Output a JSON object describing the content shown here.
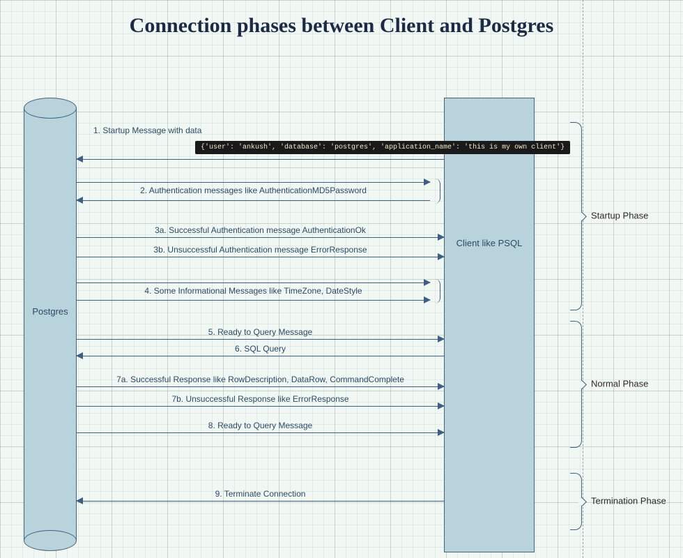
{
  "title": "Connection phases between Client and Postgres",
  "left_entity": "Postgres",
  "right_entity": "Client like PSQL",
  "code_snippet": "{'user': 'ankush', 'database': 'postgres', 'application_name': 'this is my own client'}",
  "messages": {
    "m1": "1. Startup Message with data",
    "m2": "2. Authentication messages like AuthenticationMD5Password",
    "m3a": "3a. Successful Authentication message AuthenticationOk",
    "m3b": "3b. Unsuccessful Authentication message ErrorResponse",
    "m4": "4. Some Informational Messages like TimeZone, DateStyle",
    "m5": "5. Ready to Query Message",
    "m6": "6. SQL Query",
    "m7a": "7a. Successful Response like RowDescription, DataRow,  CommandComplete",
    "m7b": "7b. Unsuccessful Response like ErrorResponse",
    "m8": "8. Ready to Query Message",
    "m9": "9. Terminate Connection"
  },
  "phases": {
    "startup": "Startup Phase",
    "normal": "Normal Phase",
    "termination": "Termination Phase"
  }
}
